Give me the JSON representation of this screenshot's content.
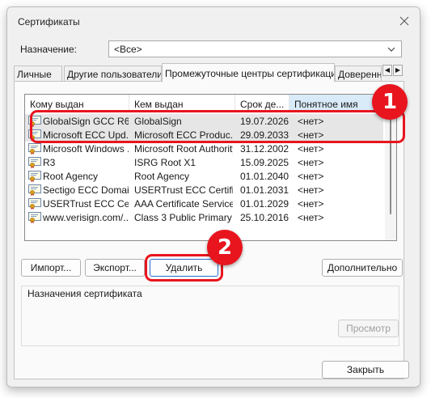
{
  "window": {
    "title": "Сертификаты"
  },
  "purpose": {
    "label": "Назначение:",
    "value": "<Все>"
  },
  "tabs": [
    "Личные",
    "Другие пользователи",
    "Промежуточные центры сертификации",
    "Доверенн"
  ],
  "active_tab": 2,
  "list": {
    "columns": [
      "Кому выдан",
      "Кем выдан",
      "Срок де...",
      "Понятное имя"
    ],
    "sorted_column": 3,
    "rows": [
      {
        "issued_to": "GlobalSign GCC R6 ...",
        "issued_by": "GlobalSign",
        "expires": "19.07.2026",
        "name": "<нет>",
        "selected": true
      },
      {
        "issued_to": "Microsoft ECC Upd...",
        "issued_by": "Microsoft ECC Produc...",
        "expires": "29.09.2033",
        "name": "<нет>",
        "selected": true
      },
      {
        "issued_to": "Microsoft Windows ...",
        "issued_by": "Microsoft Root Authority",
        "expires": "31.12.2002",
        "name": "<нет>",
        "selected": false
      },
      {
        "issued_to": "R3",
        "issued_by": "ISRG Root X1",
        "expires": "15.09.2025",
        "name": "<нет>",
        "selected": false
      },
      {
        "issued_to": "Root Agency",
        "issued_by": "Root Agency",
        "expires": "01.01.2040",
        "name": "<нет>",
        "selected": false
      },
      {
        "issued_to": "Sectigo ECC Domai...",
        "issued_by": "USERTrust ECC Certifi...",
        "expires": "01.01.2031",
        "name": "<нет>",
        "selected": false
      },
      {
        "issued_to": "USERTrust ECC Cer...",
        "issued_by": "AAA Certificate Services",
        "expires": "01.01.2029",
        "name": "<нет>",
        "selected": false
      },
      {
        "issued_to": "www.verisign.com/...",
        "issued_by": "Class 3 Public Primary ...",
        "expires": "25.10.2016",
        "name": "<нет>",
        "selected": false
      }
    ]
  },
  "buttons": {
    "import": "Импорт...",
    "export": "Экспорт...",
    "delete": "Удалить",
    "advanced": "Дополнительно",
    "view": "Просмотр",
    "close": "Закрыть"
  },
  "purposes_group": {
    "label": "Назначения сертификата"
  },
  "annotations": {
    "step1": "1",
    "step2": "2"
  },
  "colors": {
    "callout": "#e8151e",
    "selection": "#e6e6e6",
    "sorted_header": "#d9ebf9"
  },
  "icons": {
    "certificate": "certificate-icon",
    "close": "close-icon",
    "dropdown": "chevron-down-icon"
  }
}
